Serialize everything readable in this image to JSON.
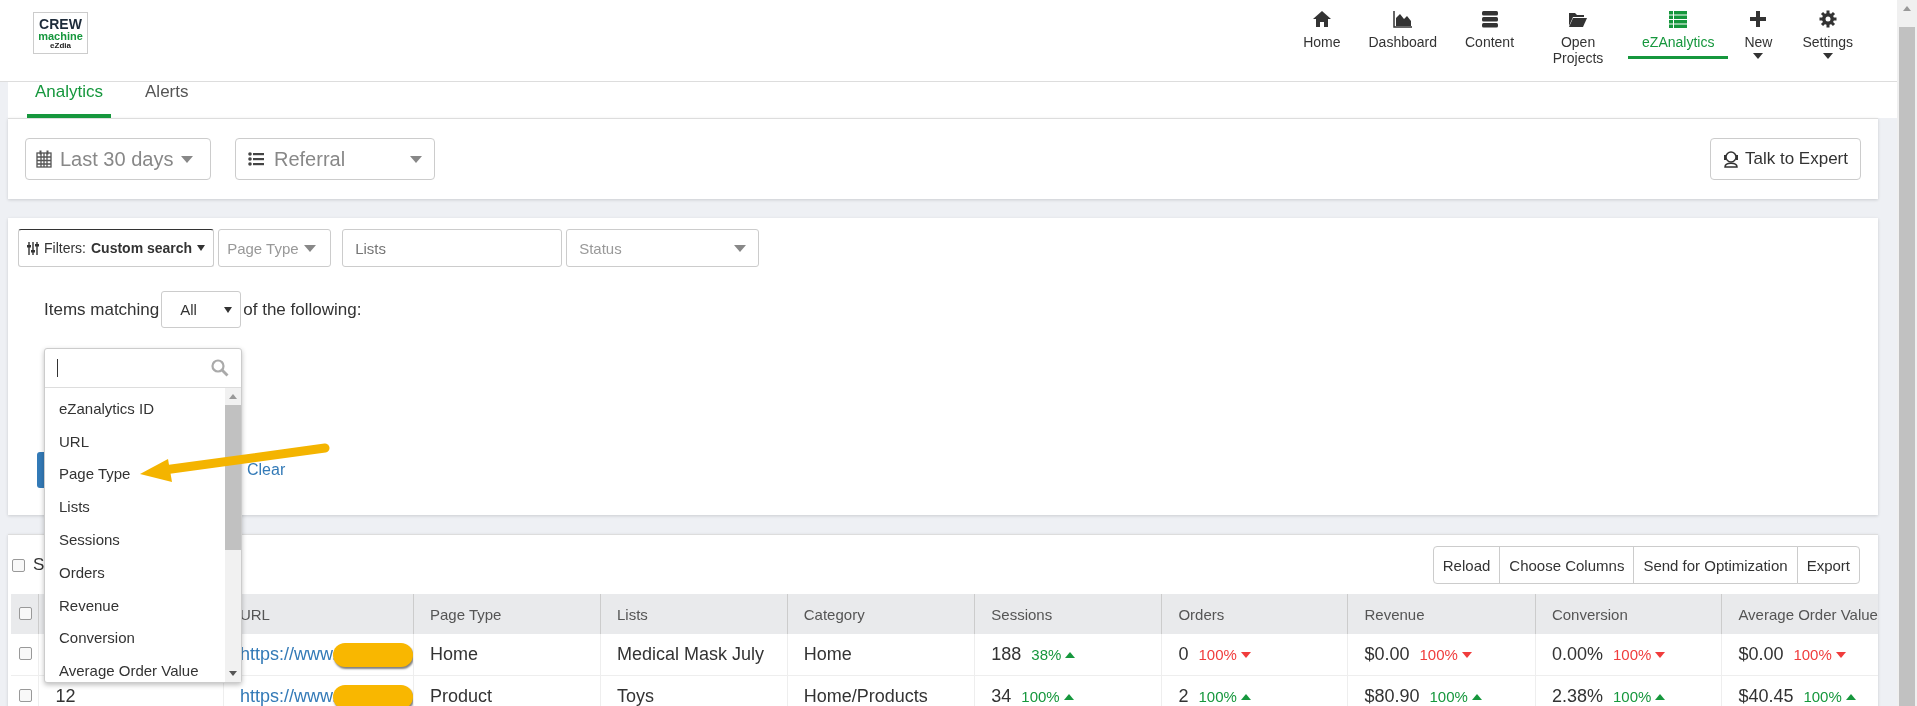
{
  "logo": {
    "line1": "CREW",
    "line2": "machine",
    "line3": "eZdia"
  },
  "nav": [
    {
      "label": "Home",
      "selected": false,
      "caret": false
    },
    {
      "label": "Dashboard",
      "selected": false,
      "caret": false
    },
    {
      "label": "Content",
      "selected": false,
      "caret": false
    },
    {
      "label": "Open Projects",
      "selected": false,
      "caret": false
    },
    {
      "label": "eZAnalytics",
      "selected": true,
      "caret": false
    },
    {
      "label": "New",
      "selected": false,
      "caret": true
    },
    {
      "label": "Settings",
      "selected": false,
      "caret": true
    }
  ],
  "tabs": [
    {
      "label": "Analytics",
      "selected": true
    },
    {
      "label": "Alerts",
      "selected": false
    }
  ],
  "toolbar": {
    "date_range": "Last 30 days",
    "source": "Referral",
    "talk_button": "Talk to Expert"
  },
  "filters": {
    "filter_label": "Filters:",
    "filter_value": "Custom search",
    "page_type": "Page Type",
    "lists_placeholder": "Lists",
    "status": "Status",
    "matching_prefix": "Items matching",
    "matching_value": "All",
    "matching_suffix": "of the following:",
    "clear_link": "Clear"
  },
  "dropdown": {
    "options": [
      {
        "label": "eZanalytics ID"
      },
      {
        "label": "URL"
      },
      {
        "label": "Page Type"
      },
      {
        "label": "Lists"
      },
      {
        "label": "Sessions"
      },
      {
        "label": "Orders"
      },
      {
        "label": "Revenue"
      },
      {
        "label": "Conversion"
      },
      {
        "label": "Average Order Value"
      }
    ]
  },
  "table": {
    "select_all": {
      "label": "S",
      "checked": false
    },
    "buttons": [
      "Reload",
      "Choose Columns",
      "Send for Optimization",
      "Export"
    ],
    "header_checked": false,
    "columns": [
      "URL",
      "Page Type",
      "Lists",
      "Category",
      "Sessions",
      "Orders",
      "Revenue",
      "Conversion",
      "Average Order Value"
    ],
    "rows": [
      {
        "checked": false,
        "url": "https://www.",
        "page_type": "Home",
        "lists": "Medical Mask July",
        "category": "Home",
        "metrics": [
          {
            "value": "188",
            "change": "38%",
            "rising": true
          },
          {
            "value": "0",
            "change": "100%",
            "rising": false
          },
          {
            "value": "$0.00",
            "change": "100%",
            "rising": false
          },
          {
            "value": "0.00%",
            "change": "100%",
            "rising": false
          },
          {
            "value": "$0.00",
            "change": "100%",
            "rising": false
          }
        ]
      },
      {
        "checked": false,
        "id": "12",
        "url": "https://www.",
        "page_type": "Product",
        "lists": "Toys",
        "category": "Home/Products",
        "metrics": [
          {
            "value": "34",
            "change": "100%",
            "rising": true
          },
          {
            "value": "2",
            "change": "100%",
            "rising": true
          },
          {
            "value": "$80.90",
            "change": "100%",
            "rising": true
          },
          {
            "value": "2.38%",
            "change": "100%",
            "rising": true
          },
          {
            "value": "$40.45",
            "change": "100%",
            "rising": true
          }
        ]
      }
    ]
  }
}
